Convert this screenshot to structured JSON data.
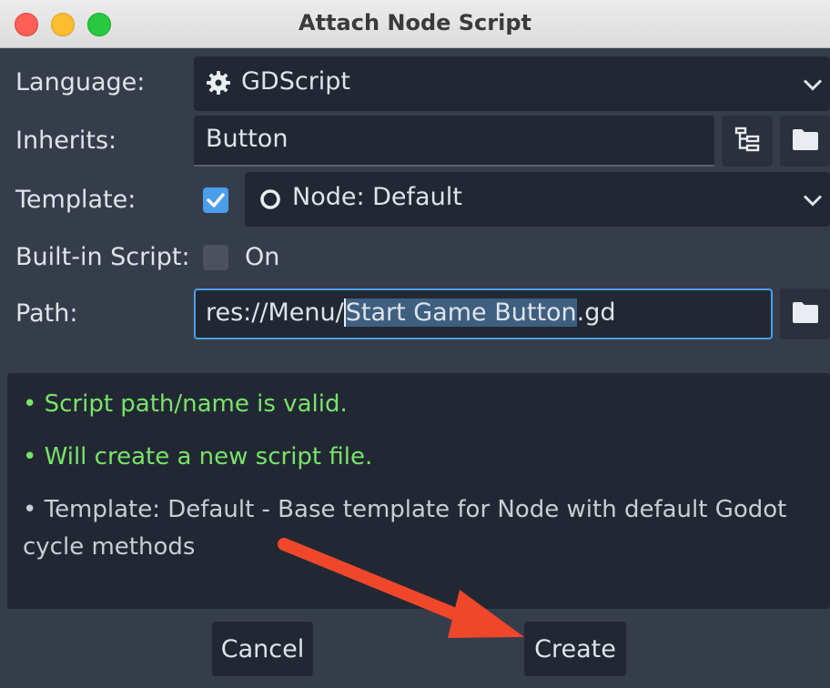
{
  "window": {
    "title": "Attach Node Script"
  },
  "form": {
    "language": {
      "label": "Language:",
      "value": "GDScript"
    },
    "inherits": {
      "label": "Inherits:",
      "value": "Button"
    },
    "template": {
      "label": "Template:",
      "checked": true,
      "value": "Node: Default"
    },
    "builtin": {
      "label": "Built-in Script:",
      "checked": false,
      "toggle_label": "On"
    },
    "path": {
      "label": "Path:",
      "prefix": "res://Menu/",
      "selected": "Start Game Button",
      "suffix": ".gd"
    }
  },
  "messages": [
    {
      "text": "•  Script path/name is valid.",
      "status": "ok"
    },
    {
      "text": "•  Will create a new script file.",
      "status": "ok"
    },
    {
      "text": "•  Template: Default - Base template for Node with default Godot cycle methods",
      "status": "info"
    }
  ],
  "buttons": {
    "cancel": "Cancel",
    "create": "Create"
  },
  "colors": {
    "accent": "#4b9eea",
    "valid": "#78e36a",
    "annotation_arrow": "#f0472b",
    "panel": "#363d4a",
    "field": "#222833"
  },
  "icons": {
    "language": "gear-icon",
    "node_tree": "node-tree-icon",
    "folder": "folder-icon",
    "template": "circle-icon",
    "dropdown": "chevron-down-icon",
    "check": "checkmark-icon"
  }
}
